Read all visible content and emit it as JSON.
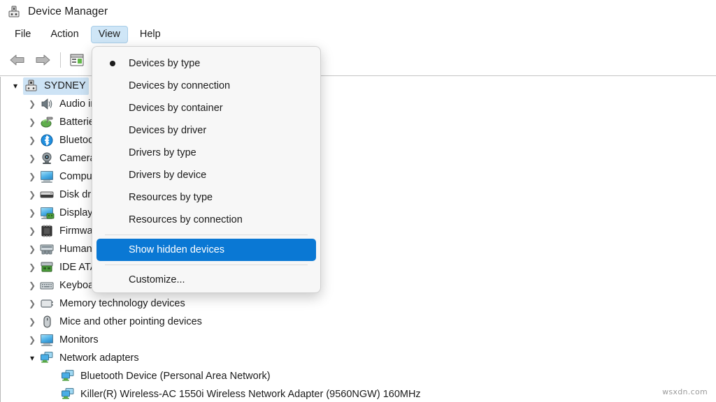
{
  "window": {
    "title": "Device Manager",
    "app_icon": "device-manager-icon"
  },
  "menubar": {
    "items": [
      {
        "label": "File",
        "active": false
      },
      {
        "label": "Action",
        "active": false
      },
      {
        "label": "View",
        "active": true
      },
      {
        "label": "Help",
        "active": false
      }
    ]
  },
  "toolbar": {
    "items": [
      {
        "name": "back-arrow-icon",
        "label": "Back"
      },
      {
        "name": "forward-arrow-icon",
        "label": "Forward"
      },
      {
        "name": "properties-icon",
        "label": "Properties"
      }
    ]
  },
  "view_menu": {
    "items": [
      {
        "label": "Devices by type",
        "checked": true,
        "highlight": false,
        "separator_after": false
      },
      {
        "label": "Devices by connection",
        "checked": false,
        "highlight": false,
        "separator_after": false
      },
      {
        "label": "Devices by container",
        "checked": false,
        "highlight": false,
        "separator_after": false
      },
      {
        "label": "Devices by driver",
        "checked": false,
        "highlight": false,
        "separator_after": false
      },
      {
        "label": "Drivers by type",
        "checked": false,
        "highlight": false,
        "separator_after": false
      },
      {
        "label": "Drivers by device",
        "checked": false,
        "highlight": false,
        "separator_after": false
      },
      {
        "label": "Resources by type",
        "checked": false,
        "highlight": false,
        "separator_after": false
      },
      {
        "label": "Resources by connection",
        "checked": false,
        "highlight": false,
        "separator_after": true
      },
      {
        "label": "Show hidden devices",
        "checked": false,
        "highlight": true,
        "separator_after": true
      },
      {
        "label": "Customize...",
        "checked": false,
        "highlight": false,
        "separator_after": false
      }
    ],
    "highlight_color": "#0a78d4"
  },
  "tree": {
    "rows": [
      {
        "label": "SYDNEY",
        "icon": "computer-icon",
        "expander": "down",
        "indent": 0,
        "selected": true
      },
      {
        "label": "Audio inputs and outputs",
        "icon": "speaker-icon",
        "expander": "right",
        "indent": 1,
        "selected": false
      },
      {
        "label": "Batteries",
        "icon": "battery-icon",
        "expander": "right",
        "indent": 1,
        "selected": false
      },
      {
        "label": "Bluetooth",
        "icon": "bluetooth-icon",
        "expander": "right",
        "indent": 1,
        "selected": false
      },
      {
        "label": "Cameras",
        "icon": "camera-icon",
        "expander": "right",
        "indent": 1,
        "selected": false
      },
      {
        "label": "Computer",
        "icon": "computer-monitor-icon",
        "expander": "right",
        "indent": 1,
        "selected": false
      },
      {
        "label": "Disk drives",
        "icon": "disk-drive-icon",
        "expander": "right",
        "indent": 1,
        "selected": false
      },
      {
        "label": "Display adapters",
        "icon": "display-adapter-icon",
        "expander": "right",
        "indent": 1,
        "selected": false
      },
      {
        "label": "Firmware",
        "icon": "firmware-chip-icon",
        "expander": "right",
        "indent": 1,
        "selected": false
      },
      {
        "label": "Human Interface Devices",
        "icon": "hid-icon",
        "expander": "right",
        "indent": 1,
        "selected": false
      },
      {
        "label": "IDE ATA/ATAPI controllers",
        "icon": "ide-controller-icon",
        "expander": "right",
        "indent": 1,
        "selected": false
      },
      {
        "label": "Keyboards",
        "icon": "keyboard-icon",
        "expander": "right",
        "indent": 1,
        "selected": false
      },
      {
        "label": "Memory technology devices",
        "icon": "memory-icon",
        "expander": "right",
        "indent": 1,
        "selected": false
      },
      {
        "label": "Mice and other pointing devices",
        "icon": "mouse-icon",
        "expander": "right",
        "indent": 1,
        "selected": false
      },
      {
        "label": "Monitors",
        "icon": "monitor-icon",
        "expander": "right",
        "indent": 1,
        "selected": false
      },
      {
        "label": "Network adapters",
        "icon": "network-adapter-icon",
        "expander": "down",
        "indent": 1,
        "selected": false
      },
      {
        "label": "Bluetooth Device (Personal Area Network)",
        "icon": "network-adapter-icon",
        "expander": "none",
        "indent": 2,
        "selected": false
      },
      {
        "label": "Killer(R) Wireless-AC 1550i Wireless Network Adapter (9560NGW) 160MHz",
        "icon": "network-adapter-icon",
        "expander": "none",
        "indent": 2,
        "selected": false
      }
    ]
  },
  "watermark": {
    "text": "wsxdn.com"
  }
}
